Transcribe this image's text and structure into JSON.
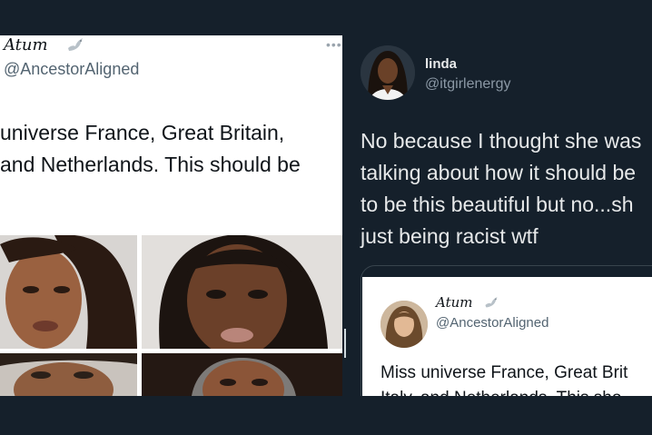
{
  "left_tweet": {
    "display_name": "Atum",
    "handle": "@AncestorAligned",
    "more_icon": "more-horizontal-icon",
    "text_lines": [
      "universe France, Great Britain,",
      "and Netherlands. This should be"
    ],
    "photos": [
      "portrait-1",
      "portrait-2",
      "portrait-3",
      "portrait-4"
    ]
  },
  "main_tweet": {
    "display_name": "linda",
    "handle": "@itgirlenergy",
    "text_lines": [
      "No because I thought she was",
      "talking about how it should be",
      "to be this beautiful but no...sh",
      "just being racist wtf"
    ]
  },
  "quoted_tweet": {
    "display_name": "Atum",
    "handle": "@AncestorAligned",
    "text_lines": [
      "Miss universe France, Great Brit",
      "Italy, and Netherlands. This sho"
    ]
  },
  "colors": {
    "background": "#15202b",
    "card": "#ffffff",
    "text_dark": "#0f1419",
    "text_light": "#e7e9ea",
    "muted": "#8b98a5"
  }
}
